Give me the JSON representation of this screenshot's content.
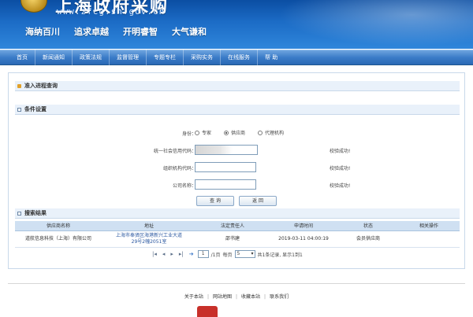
{
  "header": {
    "title": "上海政府采购",
    "url": "www.zfcg.sh.gov.cn",
    "slogans": [
      "海纳百川",
      "追求卓越",
      "开明睿智",
      "大气谦和"
    ]
  },
  "nav": [
    "首页",
    "新闻通知",
    "政策法规",
    "监督管理",
    "专题专栏",
    "采购实务",
    "在线服务",
    "帮 助"
  ],
  "query": {
    "title": "准入进程查询",
    "section": "条件设置",
    "identity_label": "身份：",
    "identity_options": [
      {
        "label": "专家",
        "selected": false
      },
      {
        "label": "供应商",
        "selected": true
      },
      {
        "label": "代理机构",
        "selected": false
      }
    ],
    "fields": [
      {
        "label": "统一社会信用代码：",
        "value": "",
        "status": "校验成功!"
      },
      {
        "label": "组织机构代码：",
        "value": "",
        "status": "校验成功!"
      },
      {
        "label": "公司名称：",
        "value": "",
        "status": "校验成功!"
      }
    ],
    "query_button": "查 询",
    "back_button": "返 回"
  },
  "results": {
    "title": "搜索结果",
    "columns": [
      "供应商名称",
      "地址",
      "法定责任人",
      "申请时间",
      "状态",
      "相关操作"
    ],
    "rows": [
      {
        "name": "道航信息科技（上海）有限公司",
        "address_line1": "上海市奉贤区海港新兴工业大道",
        "address_line2": "29号2幢2051室",
        "person": "邵书建",
        "time": "2019-03-11 04:00:19",
        "status": "会员供应商",
        "action": ""
      }
    ],
    "pager": {
      "page": "1",
      "page_total_text": "/1页",
      "per_page_label": "每页",
      "per_page": "5",
      "summary": "共1条记录, 显示1到1"
    }
  },
  "footer": {
    "links": [
      "关于本站",
      "网站地图",
      "收藏本站",
      "联系我们"
    ]
  },
  "colors": {
    "banner": "#1c6cc6",
    "nav": "#3b7cc8",
    "table_header": "#cfe0f2",
    "link": "#2a57a0"
  }
}
